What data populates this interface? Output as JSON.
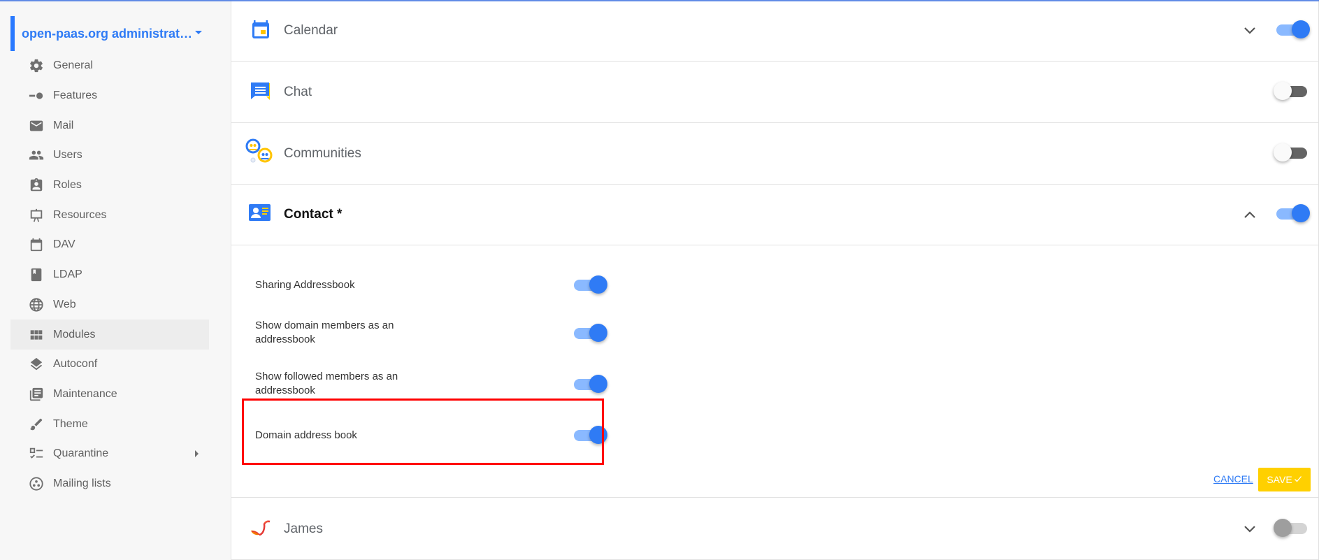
{
  "sidebar": {
    "domain_title": "open-paas.org administrat…",
    "items": [
      {
        "label": "General",
        "icon": "gear-icon"
      },
      {
        "label": "Features",
        "icon": "features-toggle-icon"
      },
      {
        "label": "Mail",
        "icon": "mail-icon"
      },
      {
        "label": "Users",
        "icon": "users-icon"
      },
      {
        "label": "Roles",
        "icon": "roles-badge-icon"
      },
      {
        "label": "Resources",
        "icon": "presentation-easel-icon"
      },
      {
        "label": "DAV",
        "icon": "calendar-icon"
      },
      {
        "label": "LDAP",
        "icon": "bookmark-book-icon"
      },
      {
        "label": "Web",
        "icon": "globe-icon"
      },
      {
        "label": "Modules",
        "icon": "grid-icon",
        "active": true
      },
      {
        "label": "Autoconf",
        "icon": "layers-icon"
      },
      {
        "label": "Maintenance",
        "icon": "library-books-icon"
      },
      {
        "label": "Theme",
        "icon": "brush-icon"
      },
      {
        "label": "Quarantine",
        "icon": "checklist-icon",
        "has_submenu": true
      },
      {
        "label": "Mailing lists",
        "icon": "mailing-lists-icon"
      }
    ]
  },
  "modules": [
    {
      "name": "Calendar",
      "icon": "calendar-module-icon",
      "enabled": true,
      "expanded": false
    },
    {
      "name": "Chat",
      "icon": "chat-module-icon",
      "enabled": false
    },
    {
      "name": "Communities",
      "icon": "communities-module-icon",
      "enabled": false
    },
    {
      "name": "Contact *",
      "icon": "contact-module-icon",
      "enabled": true,
      "expanded": true
    },
    {
      "name": "James",
      "icon": "james-module-icon",
      "enabled": false,
      "disabled": true,
      "expanded": false
    }
  ],
  "contact_settings": [
    {
      "label": "Sharing Addressbook",
      "enabled": true
    },
    {
      "label": "Show domain members as an addressbook",
      "enabled": true
    },
    {
      "label": "Show followed members as an addressbook",
      "enabled": true
    },
    {
      "label": "Domain address book",
      "enabled": true,
      "highlighted": true
    }
  ],
  "actions": {
    "cancel_label": "CANCEL",
    "save_label": "SAVE"
  },
  "colors": {
    "accent": "#2f7bf5",
    "save": "#ffd000",
    "highlight": "#ff0000"
  }
}
